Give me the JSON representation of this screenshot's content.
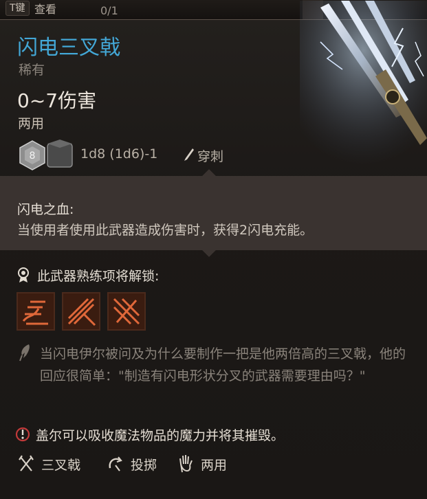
{
  "topbar": {
    "key_badge": "T键",
    "key_label": "查看",
    "count": "0/1"
  },
  "item": {
    "name": "闪电三叉戟",
    "rarity": "稀有",
    "damage": "0~7伤害",
    "handedness": "两用",
    "dice_left": "8",
    "dice_formula": "1d8 (1d6)-1",
    "damage_type": "穿刺"
  },
  "passive": {
    "name": "闪电之血:",
    "description": "当使用者使用此武器造成伤害时，获得2闪电充能。"
  },
  "proficiency": {
    "label": "此武器熟练项将解锁:",
    "actions": [
      {
        "icon": "flourish-action-icon"
      },
      {
        "icon": "piercing-strike-action-icon"
      },
      {
        "icon": "weakening-strike-action-icon"
      }
    ]
  },
  "lore": "当闪电伊尔被问及为什么要制作一把是他两倍高的三叉戟，他的回应很简单：\"制造有闪电形状分叉的武器需要理由吗？\"",
  "special": "盖尔可以吸收魔法物品的魔力并将其摧毁。",
  "tags": [
    {
      "label": "三叉戟",
      "icon": "trident-icon"
    },
    {
      "label": "投掷",
      "icon": "throw-icon"
    },
    {
      "label": "两用",
      "icon": "versatile-hand-icon"
    }
  ],
  "colors": {
    "title": "#43a7d6",
    "rarity": "#8c857d",
    "lore": "#8a837b",
    "action_bg": "#2b1810",
    "action_line": "#e0683a"
  }
}
